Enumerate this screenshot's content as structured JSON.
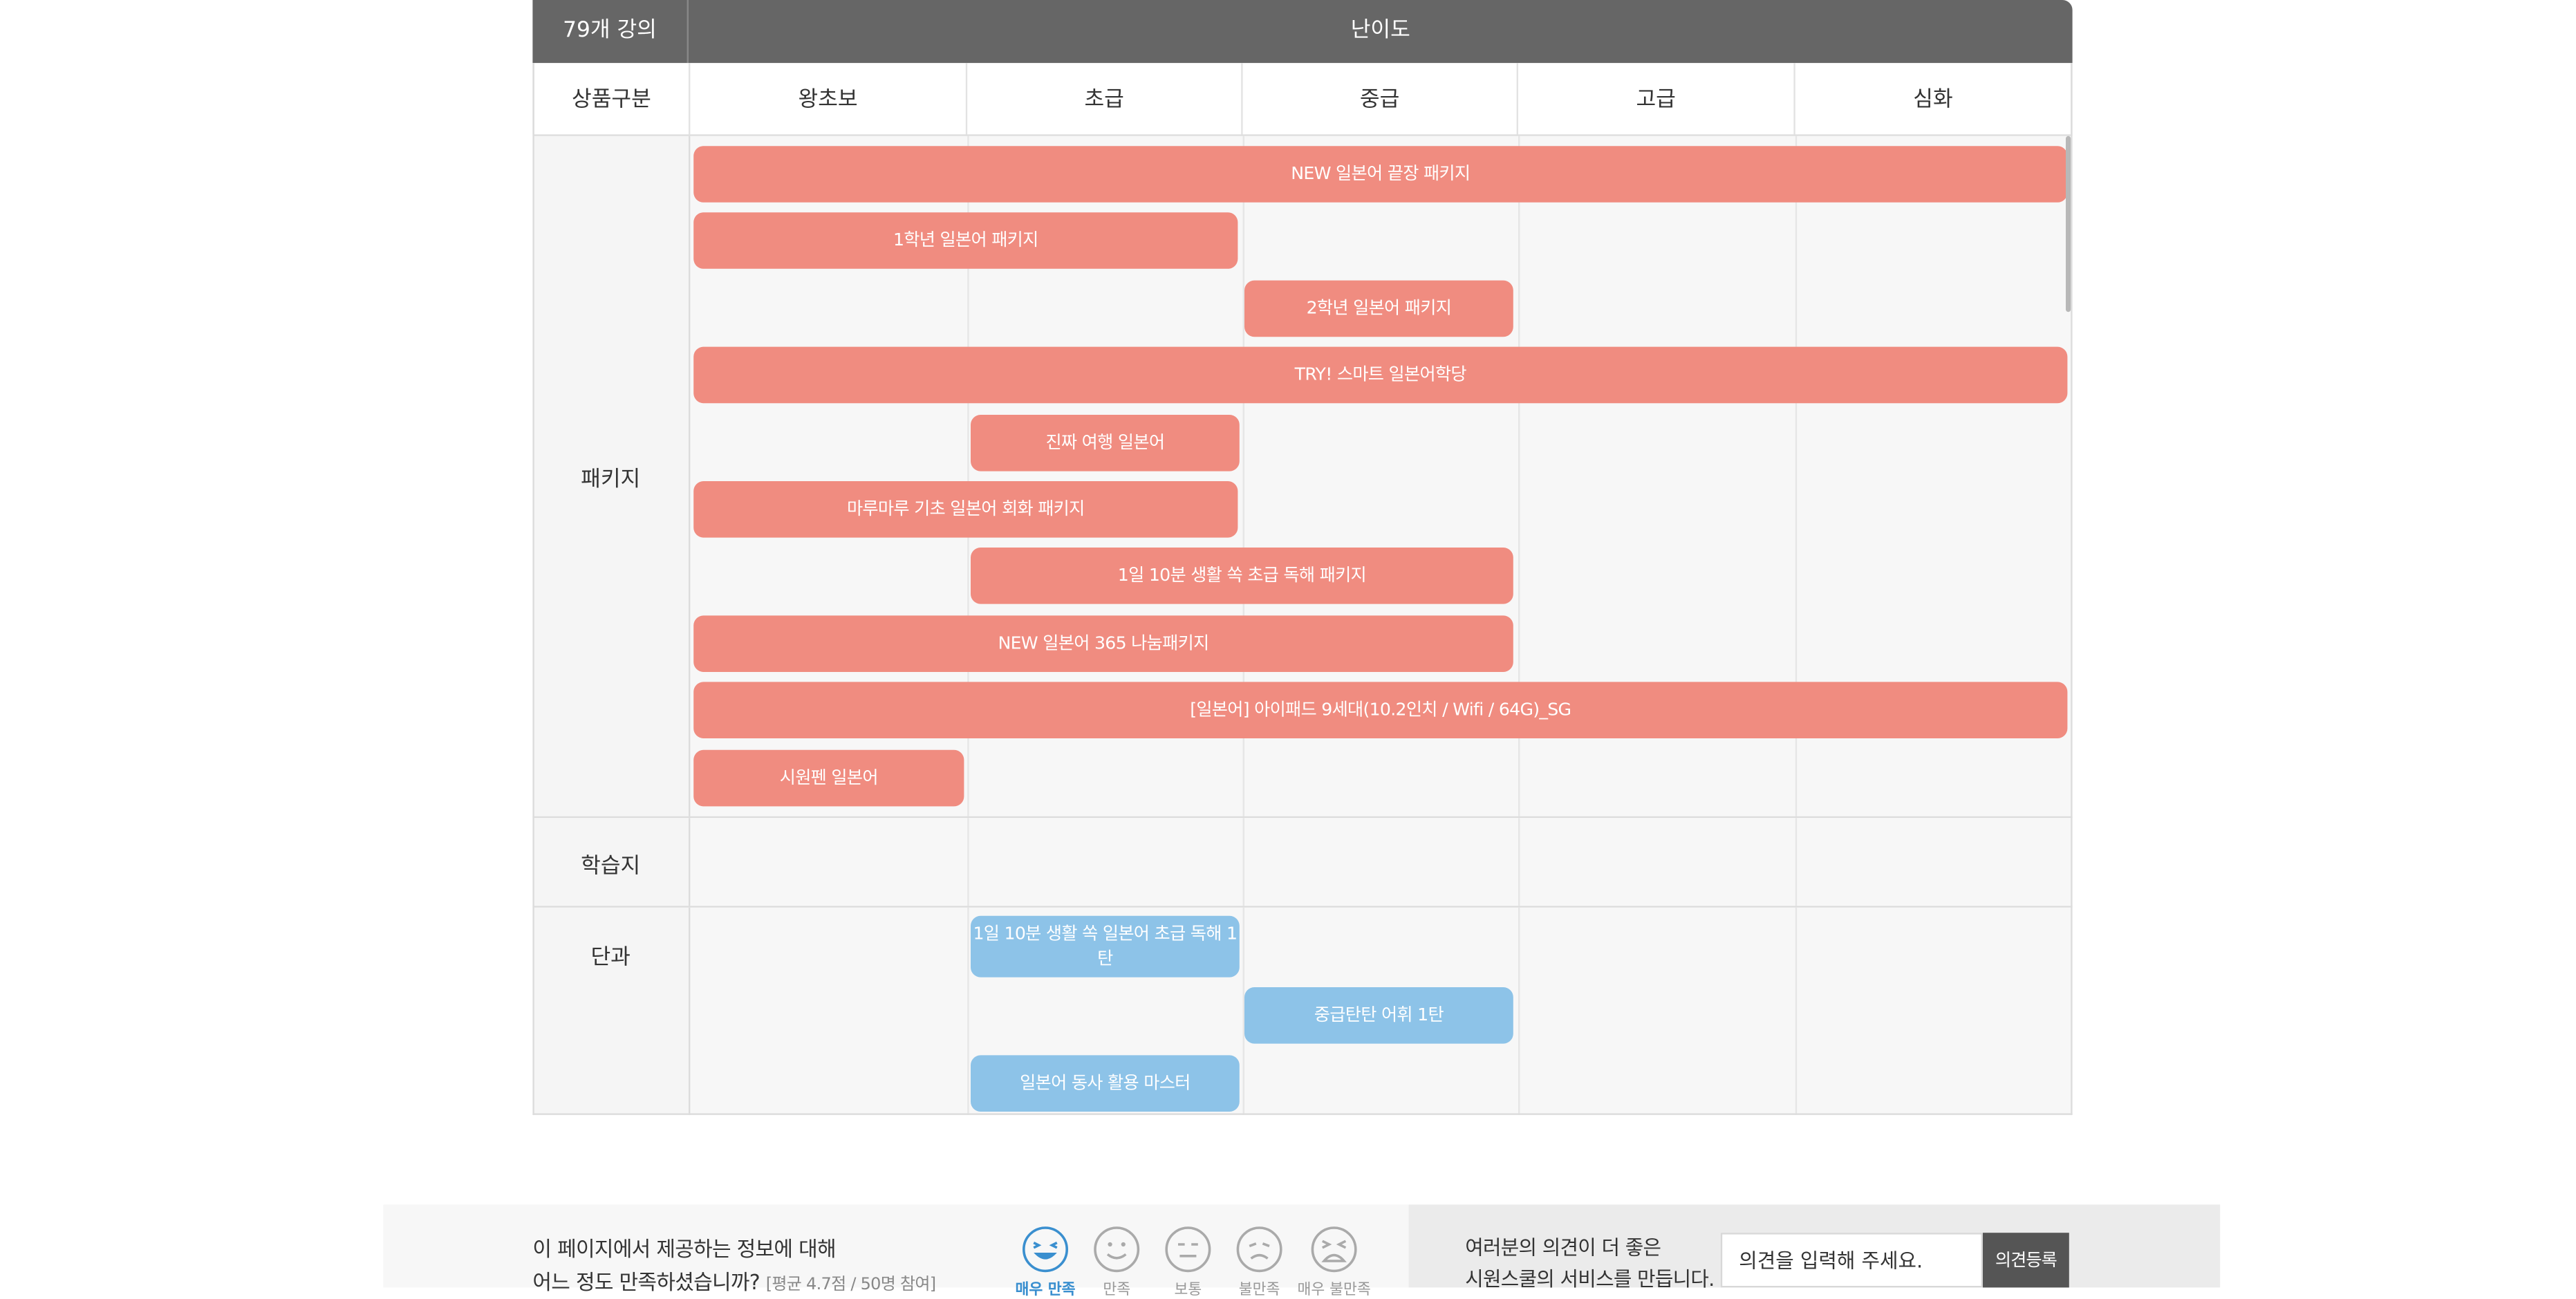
{
  "table": {
    "course_count": "79개 강의",
    "difficulty_header": "난이도",
    "category_header": "상품구분",
    "levels": [
      "왕초보",
      "초급",
      "중급",
      "고급",
      "심화"
    ],
    "categories": {
      "package": "패키지",
      "workbook": "학습지",
      "single": "단과"
    },
    "packages": [
      "NEW 일본어 끝장 패키지",
      "1학년 일본어 패키지",
      "2학년 일본어 패키지",
      "TRY! 스마트 일본어학당",
      "진짜 여행 일본어",
      "마루마루 기초 일본어 회화 패키지",
      "1일 10분 생활 쏙 초급 독해 패키지",
      "NEW 일본어 365 나눔패키지",
      "[일본어] 아이패드 9세대(10.2인치 / Wifi / 64G)_SG",
      "시원펜 일본어"
    ],
    "singles": [
      "1일 10분 생활 쏙 일본어 초급 독해 1탄",
      "중급탄탄 어휘 1탄",
      "일본어 동사 활용 마스터"
    ]
  },
  "feedback": {
    "question_line1": "이 페이지에서 제공하는 정보에 대해",
    "question_line2": "어느 정도 만족하셨습니까?",
    "average": "[평균 4.7점 / 50명 참여]",
    "ratings": [
      {
        "label": "매우 만족",
        "icon": "very-satisfied-face-icon",
        "selected": true
      },
      {
        "label": "만족",
        "icon": "satisfied-face-icon",
        "selected": false
      },
      {
        "label": "보통",
        "icon": "neutral-face-icon",
        "selected": false
      },
      {
        "label": "불만족",
        "icon": "dissatisfied-face-icon",
        "selected": false
      },
      {
        "label": "매우 불만족",
        "icon": "very-dissatisfied-face-icon",
        "selected": false
      }
    ],
    "opinion_line1": "여러분의 의견이 더 좋은",
    "opinion_line2": "시원스쿨의 서비스를 만듭니다.",
    "opinion_placeholder": "의견을 입력해 주세요.",
    "submit_label": "의견등록"
  },
  "colors": {
    "header_bg": "#666666",
    "package_bar": "#f08c80",
    "single_bar": "#8dc3e8",
    "selected_rating": "#3a8fcf"
  }
}
